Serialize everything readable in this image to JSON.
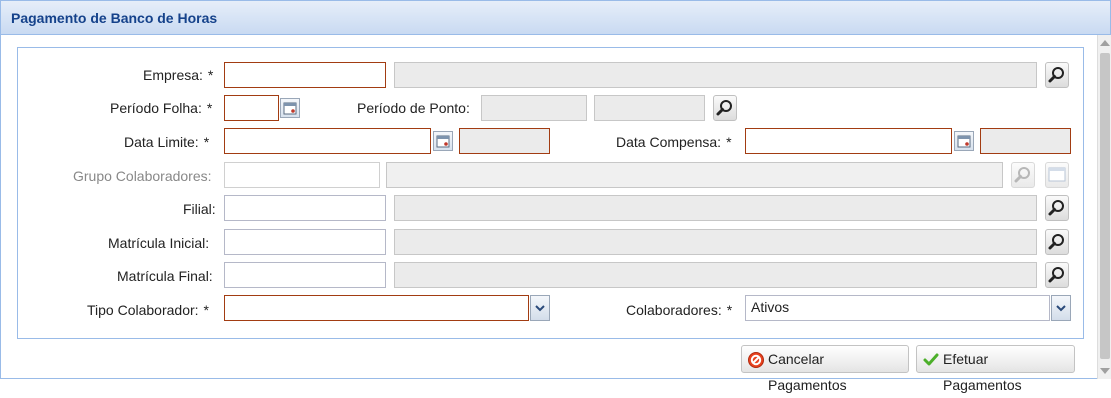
{
  "window": {
    "title": "Pagamento de Banco de Horas"
  },
  "form": {
    "empresa": {
      "label": "Empresa:",
      "required_mark": "*",
      "value": "",
      "description": ""
    },
    "periodo_folha": {
      "label": "Período Folha:",
      "required_mark": "*",
      "value": ""
    },
    "periodo_ponto": {
      "label": "Período de Ponto:",
      "start": "",
      "end": ""
    },
    "data_limite": {
      "label": "Data Limite:",
      "required_mark": "*",
      "value": "",
      "extra": ""
    },
    "data_compensa": {
      "label": "Data Compensa:",
      "required_mark": "*",
      "value": "",
      "extra": ""
    },
    "grupo_colaboradores": {
      "label": "Grupo Colaboradores:",
      "value": "",
      "description": ""
    },
    "filial": {
      "label": "Filial:",
      "value": "",
      "description": ""
    },
    "matricula_inicial": {
      "label": "Matrícula Inicial:",
      "value": "",
      "description": ""
    },
    "matricula_final": {
      "label": "Matrícula Final:",
      "value": "",
      "description": ""
    },
    "tipo_colaborador": {
      "label": "Tipo Colaborador:",
      "required_mark": "*",
      "value": ""
    },
    "colaboradores": {
      "label": "Colaboradores:",
      "required_mark": "*",
      "value": "Ativos",
      "options": [
        "Ativos"
      ]
    }
  },
  "buttons": {
    "cancel": {
      "label": "Cancelar Pagamentos",
      "icon": "cancel-icon"
    },
    "confirm": {
      "label": "Efetuar Pagamentos",
      "icon": "check-icon"
    }
  },
  "colors": {
    "title": "#15428b",
    "required_border": "#a23c12",
    "panel_border": "#99bbe8",
    "readonly_bg": "#ebebeb"
  }
}
